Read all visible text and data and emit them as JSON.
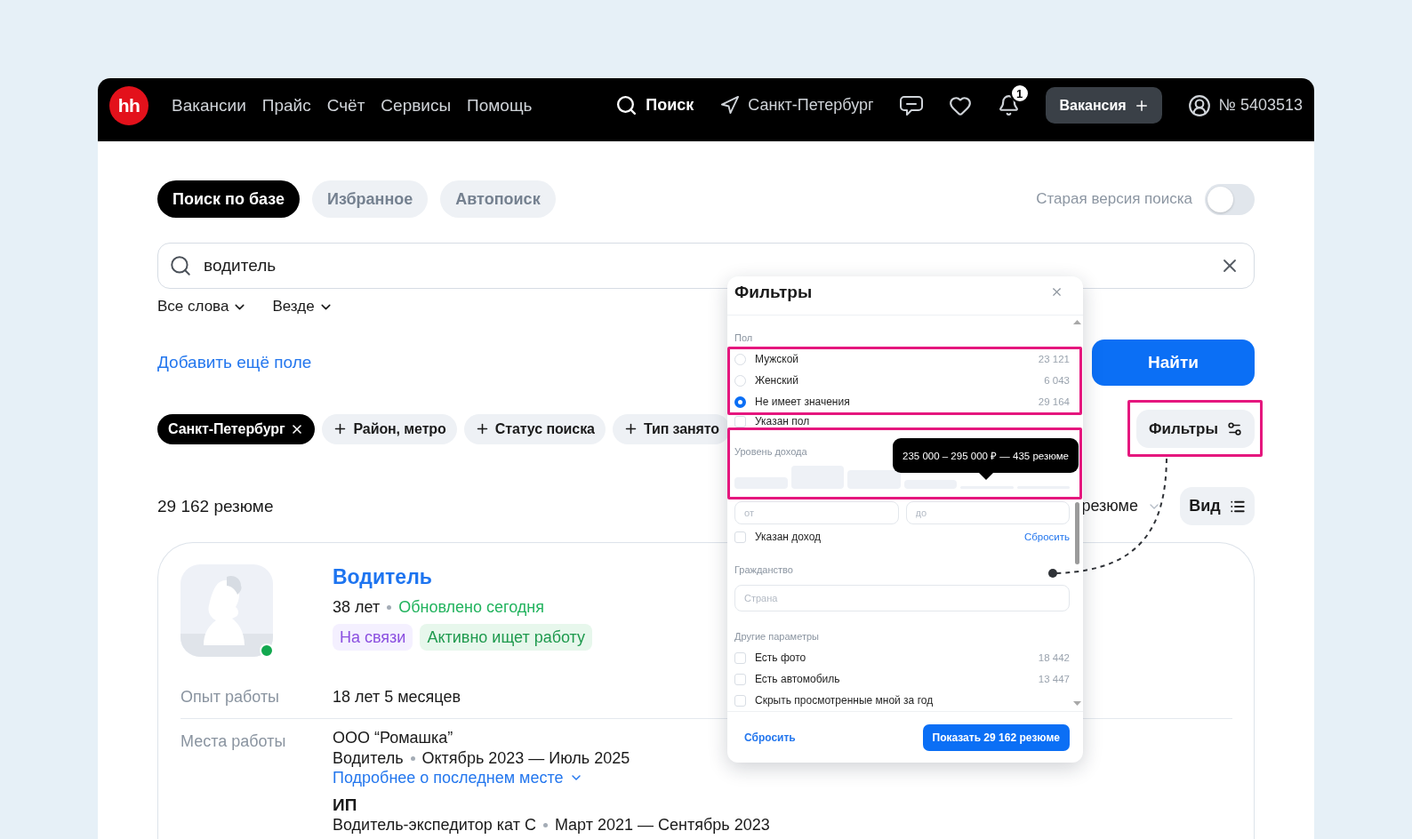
{
  "header": {
    "logo": "hh",
    "nav": [
      "Вакансии",
      "Прайс",
      "Счёт",
      "Сервисы",
      "Помощь"
    ],
    "search_link": "Поиск",
    "city": "Санкт-Петербург",
    "notification_count": "1",
    "post_button": "Вакансия",
    "account": "№ 5403513"
  },
  "tabs": [
    {
      "label": "Поиск по базе",
      "selected": true
    },
    {
      "label": "Избранное",
      "selected": false
    },
    {
      "label": "Автопоиск",
      "selected": false
    }
  ],
  "old_version_toggle": {
    "label": "Старая версия поиска",
    "on": false
  },
  "search": {
    "value": "водитель"
  },
  "search_options": [
    "Все слова",
    "Везде"
  ],
  "add_field_link": "Добавить ещё поле",
  "find_button": "Найти",
  "chips": [
    {
      "label": "Санкт-Петербург",
      "kind": "applied"
    },
    {
      "label": "Район, метро",
      "kind": "add"
    },
    {
      "label": "Статус поиска",
      "kind": "add"
    },
    {
      "label": "Тип занято",
      "kind": "add"
    }
  ],
  "filters_button": {
    "label": "Фильтры",
    "highlighted": true
  },
  "results": {
    "count": "29 162 резюме",
    "sort": "резюме",
    "view_button": "Вид"
  },
  "resume": {
    "title": "Водитель",
    "age": "38 лет",
    "updated": "Обновлено сегодня",
    "online": true,
    "tags": [
      {
        "label": "На связи",
        "kind": "contact"
      },
      {
        "label": "Активно ищет работу",
        "kind": "search_status"
      }
    ],
    "experience": {
      "label": "Опыт работы",
      "value": "18 лет 5 месяцев"
    },
    "workplaces": {
      "label": "Места работы",
      "items": [
        {
          "company": "ООО “Ромашка”",
          "position": "Водитель",
          "period": "Октябрь 2023 — Июль 2025",
          "more_link": "Подробнее о последнем месте"
        },
        {
          "company": "ИП",
          "position": "Водитель-экспедитор кат С",
          "period": "Март 2021 — Сентябрь 2023"
        }
      ]
    }
  },
  "filter_panel": {
    "title": "Фильтры",
    "gender": {
      "label": "Пол",
      "highlighted": true,
      "options": [
        {
          "label": "Мужской",
          "count": "23 121",
          "selected": false
        },
        {
          "label": "Женский",
          "count": "6 043",
          "selected": false
        },
        {
          "label": "Не имеет значения",
          "count": "29 164",
          "selected": true
        }
      ],
      "specified": {
        "label": "Указан пол",
        "checked": false
      }
    },
    "income": {
      "label": "Уровень дохода",
      "highlighted": true,
      "tooltip": "235 000 – 295 000 ₽ — 435 резюме",
      "from_placeholder": "от",
      "to_placeholder": "до",
      "specified": {
        "label": "Указан доход",
        "checked": false
      },
      "reset_link": "Сбросить"
    },
    "citizenship": {
      "label": "Гражданство",
      "placeholder": "Страна"
    },
    "other": {
      "label": "Другие параметры",
      "options": [
        {
          "label": "Есть фото",
          "count": "18 442",
          "checked": false
        },
        {
          "label": "Есть автомобиль",
          "count": "13 447",
          "checked": false
        },
        {
          "label": "Скрыть просмотренные мной за год",
          "checked": false
        }
      ]
    },
    "footer": {
      "reset": "Сбросить",
      "show_button": "Показать 29 162 резюме"
    }
  }
}
